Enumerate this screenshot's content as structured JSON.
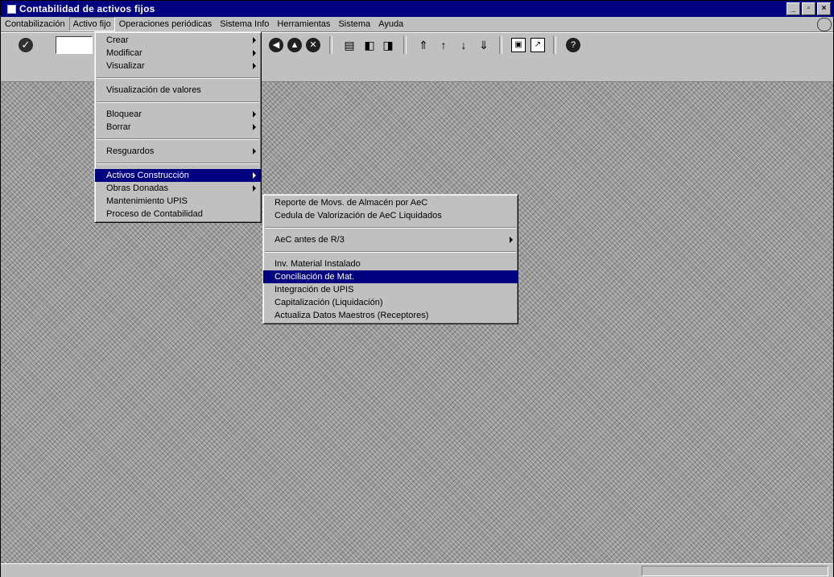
{
  "window": {
    "title": "Contabilidad de activos fijos"
  },
  "window_buttons": [
    "_",
    "▫",
    "×"
  ],
  "menubar": {
    "items": [
      "Contabilización",
      "Activo fijo",
      "Operaciones periódicas",
      "Sistema Info",
      "Herramientas",
      "Sistema",
      "Ayuda"
    ]
  },
  "activo_menu": {
    "items": [
      {
        "label": "Crear"
      },
      {
        "label": "Modificar"
      },
      {
        "label": "Visualizar"
      },
      {
        "label": "Visualización de valores"
      },
      {
        "label": "Bloquear"
      },
      {
        "label": "Borrar"
      },
      {
        "label": "Resguardos"
      },
      {
        "label": "Activos Construcción"
      },
      {
        "label": "Obras Donadas"
      },
      {
        "label": "Mantenimiento UPIS"
      },
      {
        "label": "Proceso de Contabilidad"
      }
    ]
  },
  "construccion_menu": {
    "items": [
      {
        "label": "Reporte de Movs. de Almacén por AeC"
      },
      {
        "label": "Cedula de Valorización de AeC Liquidados"
      },
      {
        "label": "AeC antes de R/3"
      },
      {
        "label": "Inv. Material Instalado"
      },
      {
        "label": "Conciliación de Mat."
      },
      {
        "label": "Integración de UPIS"
      },
      {
        "label": "Capitalización (Liquidación)"
      },
      {
        "label": "Actualiza Datos Maestros (Receptores)"
      }
    ]
  },
  "colors": {
    "title_bar": "#000080",
    "selection": "#000080",
    "face": "#c0c0c0"
  }
}
